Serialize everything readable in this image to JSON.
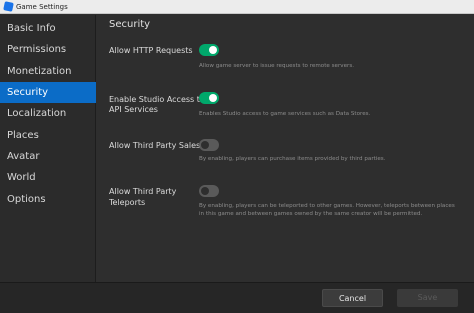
{
  "window": {
    "title": "Game Settings"
  },
  "sidebar": {
    "items": [
      {
        "label": "Basic Info",
        "active": false
      },
      {
        "label": "Permissions",
        "active": false
      },
      {
        "label": "Monetization",
        "active": false
      },
      {
        "label": "Security",
        "active": true
      },
      {
        "label": "Localization",
        "active": false
      },
      {
        "label": "Places",
        "active": false
      },
      {
        "label": "Avatar",
        "active": false
      },
      {
        "label": "World",
        "active": false
      },
      {
        "label": "Options",
        "active": false
      }
    ]
  },
  "section": {
    "title": "Security"
  },
  "settings": [
    {
      "label": "Allow HTTP Requests",
      "enabled": true,
      "description": "Allow game server to issue requests to remote servers."
    },
    {
      "label_line1": "Enable Studio Access to",
      "label_line2": "API Services",
      "enabled": true,
      "description": "Enables Studio access to game services such as Data Stores."
    },
    {
      "label": "Allow Third Party Sales",
      "enabled": false,
      "description": "By enabling, players can purchase items provided by third parties."
    },
    {
      "label_line1": "Allow Third Party",
      "label_line2": "Teleports",
      "enabled": false,
      "description_line1": "By enabling, players can be teleported to other games. However, teleports between places",
      "description_line2": "in this game and between games owned by the same creator will be permitted."
    }
  ],
  "footer": {
    "cancel_label": "Cancel",
    "save_label": "Save"
  },
  "colors": {
    "accent": "#0b6cc7",
    "toggle_on": "#00a86b",
    "toggle_off": "#5a5a5a",
    "background": "#2e2e2e"
  }
}
